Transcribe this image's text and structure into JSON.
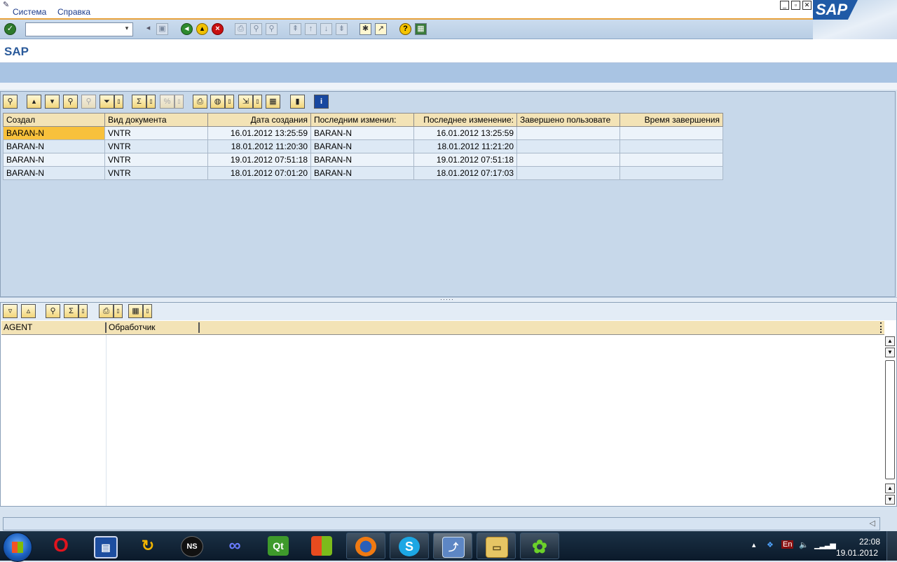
{
  "menu": {
    "items": [
      "Система",
      "Справка"
    ]
  },
  "window_buttons": {
    "minimize": "_",
    "restore": "▫",
    "close": "✕"
  },
  "brand": {
    "logo_text": "SAP"
  },
  "toolbar": {
    "command_value": "",
    "dropdown_glyph": "▾"
  },
  "page": {
    "title": "SAP"
  },
  "grid1": {
    "columns": [
      "Создал",
      "Вид документа",
      "Дата создания",
      "Последним изменил:",
      "Последнее изменение:",
      "Завершено пользовате",
      "Время завершения"
    ],
    "rows": [
      [
        "BARAN-N",
        "VNTR",
        "16.01.2012 13:25:59",
        "BARAN-N",
        "16.01.2012 13:25:59",
        "",
        ""
      ],
      [
        "BARAN-N",
        "VNTR",
        "18.01.2012 11:20:30",
        "BARAN-N",
        "18.01.2012 11:21:20",
        "",
        ""
      ],
      [
        "BARAN-N",
        "VNTR",
        "19.01.2012 07:51:18",
        "BARAN-N",
        "19.01.2012 07:51:18",
        "",
        ""
      ],
      [
        "BARAN-N",
        "VNTR",
        "18.01.2012 07:01:20",
        "BARAN-N",
        "18.01.2012 07:17:03",
        "",
        ""
      ]
    ]
  },
  "grid2": {
    "columns": [
      "AGENT",
      "Обработчик"
    ]
  },
  "statusbar": {
    "text": ""
  },
  "taskbar": {
    "apps": [
      "opera",
      "save-disk",
      "update",
      "nero",
      "infinity",
      "qt-creator",
      "windows-flag",
      "firefox",
      "skype",
      "sap-logon",
      "file-explorer",
      "icq"
    ],
    "language": "En",
    "time": "22:08",
    "date": "19.01.2012"
  }
}
